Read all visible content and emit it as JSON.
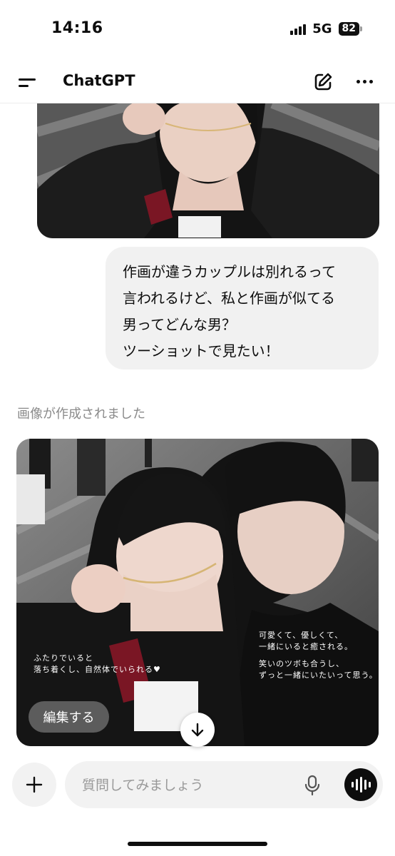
{
  "status_bar": {
    "time": "14:16",
    "network": "5G",
    "battery": "82"
  },
  "header": {
    "title": "ChatGPT"
  },
  "chat": {
    "user_message_lines": [
      "作画が違うカップルは別れるって",
      "言われるけど、私と作画が似てる",
      "男ってどんな男？",
      "ツーショットで見たい！"
    ],
    "assistant_status": "画像が作成されました",
    "image_overlay_left": [
      "ふたりでいると",
      "落ち着くし、自然体でいられる♥"
    ],
    "image_overlay_right": [
      "可愛くて、優しくて、",
      "一緒にいると癒される。",
      "笑いのツボも合うし、",
      "ずっと一緒にいたいって思う。"
    ],
    "edit_button": "編集する"
  },
  "composer": {
    "placeholder": "質問してみましょう"
  },
  "icons": {
    "menu": "menu-icon",
    "new_chat": "edit-icon",
    "more": "more-icon",
    "scroll_down": "arrow-down-icon",
    "plus": "plus-icon",
    "mic": "mic-icon",
    "voice": "voice-mode-icon"
  }
}
